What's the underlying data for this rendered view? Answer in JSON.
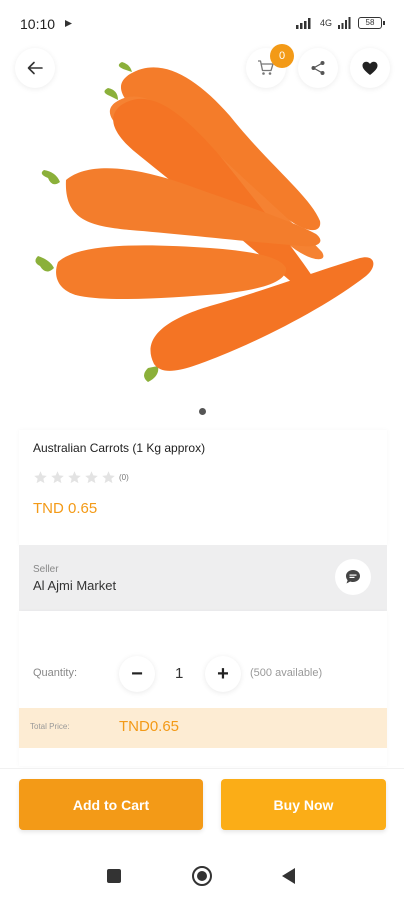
{
  "status_bar": {
    "time": "10:10",
    "network": "4G",
    "battery": "58"
  },
  "header": {
    "cart_count": "0"
  },
  "product": {
    "name": "Australian Carrots (1 Kg approx)",
    "rating_count": "(0)",
    "rating_stars": 0,
    "price": "TND 0.65",
    "image_icon": "carrots-image"
  },
  "seller": {
    "label": "Seller",
    "name": "Al Ajmi Market"
  },
  "quantity": {
    "label": "Quantity:",
    "minus": "−",
    "value": "1",
    "plus": "+",
    "available": "(500 available)"
  },
  "total": {
    "label": "Total Price:",
    "value": "TND0.65"
  },
  "actions": {
    "add_to_cart": "Add to Cart",
    "buy_now": "Buy Now"
  },
  "colors": {
    "accent": "#f39a17",
    "buy_now": "#fbad17",
    "total_bg": "#fdecd3",
    "seller_bg": "#eeeeef"
  }
}
